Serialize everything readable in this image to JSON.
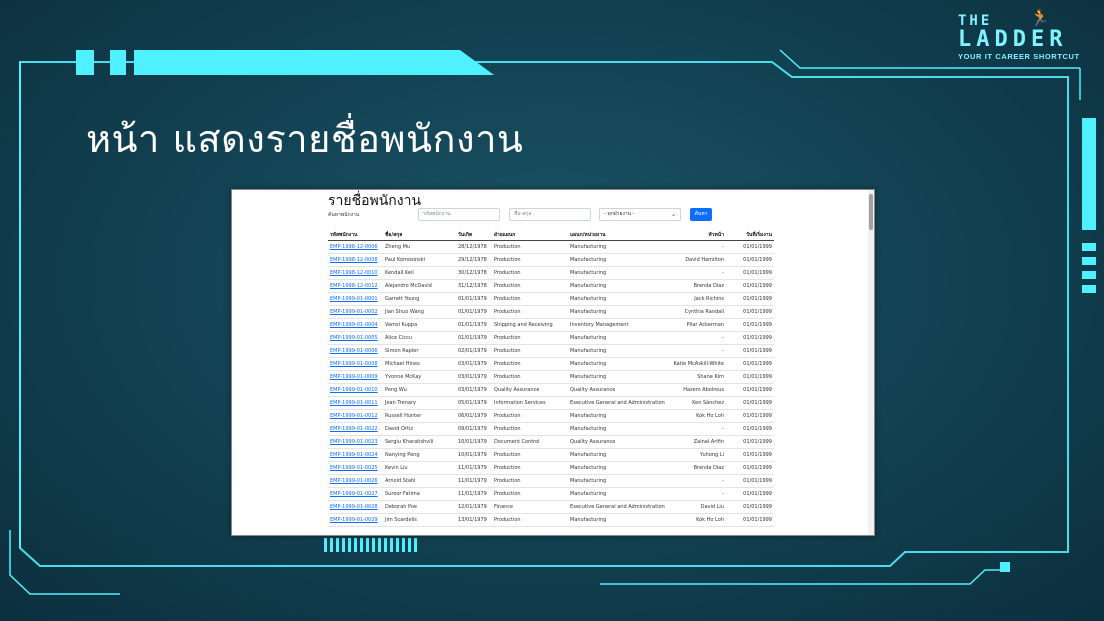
{
  "slide": {
    "title": "หน้า แสดงรายชื่อพนักงาน",
    "logo": {
      "line1": "THE",
      "line2": "LADDER",
      "tagline": "YOUR IT CAREER SHORTCUT"
    }
  },
  "app": {
    "heading": "รายชื่อพนักงาน",
    "filter": {
      "label": "ค้นหาพนักงาน",
      "code_placeholder": "รหัสพนักงาน",
      "name_placeholder": "ชื่อ-สกุล",
      "department_selected": "- ทุกฝ่ายงาน -",
      "search_label": "ค้นหา"
    },
    "columns": [
      "รหัสพนักงาน",
      "ชื่อ/สกุล",
      "วันเกิด",
      "ฝ่ายแผนก",
      "แผนก/หน่วยงาน",
      "หัวหน้า",
      "วันที่เริ่มงาน"
    ],
    "rows": [
      [
        "EMP-1998-12-0006",
        "Zheng Mu",
        "28/12/1978",
        "Production",
        "Manufacturing",
        "-",
        "01/01/1999"
      ],
      [
        "EMP-1998-12-0008",
        "Paul Komosinski",
        "29/12/1978",
        "Production",
        "Manufacturing",
        "David Hamilton",
        "01/01/1999"
      ],
      [
        "EMP-1998-12-0010",
        "Kendall Keil",
        "30/12/1978",
        "Production",
        "Manufacturing",
        "-",
        "01/01/1999"
      ],
      [
        "EMP-1998-12-0012",
        "Alejandro McDavid",
        "31/12/1978",
        "Production",
        "Manufacturing",
        "Brenda Diaz",
        "01/01/1999"
      ],
      [
        "EMP-1999-01-0001",
        "Garrett Young",
        "01/01/1979",
        "Production",
        "Manufacturing",
        "Jack Richins",
        "01/01/1999"
      ],
      [
        "EMP-1999-01-0002",
        "Jian Shuo Wang",
        "01/01/1979",
        "Production",
        "Manufacturing",
        "Cynthia Randall",
        "01/01/1999"
      ],
      [
        "EMP-1999-01-0004",
        "Vamsi Kuppa",
        "01/01/1979",
        "Shipping and Receiving",
        "Inventory Management",
        "Pilar Ackerman",
        "01/01/1999"
      ],
      [
        "EMP-1999-01-0005",
        "Alice Ciccu",
        "01/01/1979",
        "Production",
        "Manufacturing",
        "-",
        "01/01/1999"
      ],
      [
        "EMP-1999-01-0006",
        "Simon Rapier",
        "02/01/1979",
        "Production",
        "Manufacturing",
        "-",
        "01/01/1999"
      ],
      [
        "EMP-1999-01-0008",
        "Michael Hines",
        "03/01/1979",
        "Production",
        "Manufacturing",
        "Katie McAskill-White",
        "01/01/1999"
      ],
      [
        "EMP-1999-01-0009",
        "Yvonne McKay",
        "03/01/1979",
        "Production",
        "Manufacturing",
        "Shane Kim",
        "01/01/1999"
      ],
      [
        "EMP-1999-01-0010",
        "Peng Wu",
        "03/01/1979",
        "Quality Assurance",
        "Quality Assurance",
        "Hazem Abolrous",
        "01/01/1999"
      ],
      [
        "EMP-1999-01-0011",
        "Jean Trenary",
        "05/01/1979",
        "Information Services",
        "Executive General and Administration",
        "Ken Sánchez",
        "01/01/1999"
      ],
      [
        "EMP-1999-01-0012",
        "Russell Hunter",
        "06/01/1979",
        "Production",
        "Manufacturing",
        "Kok Ho Loh",
        "01/01/1999"
      ],
      [
        "EMP-1999-01-0022",
        "David Ortiz",
        "09/01/1979",
        "Production",
        "Manufacturing",
        "-",
        "01/01/1999"
      ],
      [
        "EMP-1999-01-0023",
        "Sergiu Kharatishvili",
        "10/01/1979",
        "Document Control",
        "Quality Assurance",
        "Zainal Arifin",
        "01/01/1999"
      ],
      [
        "EMP-1999-01-0024",
        "Nanying Peng",
        "10/01/1979",
        "Production",
        "Manufacturing",
        "Yuhong Li",
        "01/01/1999"
      ],
      [
        "EMP-1999-01-0025",
        "Kevin Liu",
        "11/01/1979",
        "Production",
        "Manufacturing",
        "Brenda Diaz",
        "01/01/1999"
      ],
      [
        "EMP-1999-01-0026",
        "Arnold Stahl",
        "11/01/1979",
        "Production",
        "Manufacturing",
        "-",
        "01/01/1999"
      ],
      [
        "EMP-1999-01-0027",
        "Suroor Fatima",
        "11/01/1979",
        "Production",
        "Manufacturing",
        "-",
        "01/01/1999"
      ],
      [
        "EMP-1999-01-0028",
        "Deborah Poe",
        "12/01/1979",
        "Finance",
        "Executive General and Administration",
        "David Liu",
        "01/01/1999"
      ],
      [
        "EMP-1999-01-0029",
        "Jim Scardelis",
        "13/01/1979",
        "Production",
        "Manufacturing",
        "Kok Ho Loh",
        "01/01/1999"
      ]
    ]
  },
  "colors": {
    "accent": "#4ff0ff",
    "background": "#134455",
    "link": "#0d6efd"
  }
}
